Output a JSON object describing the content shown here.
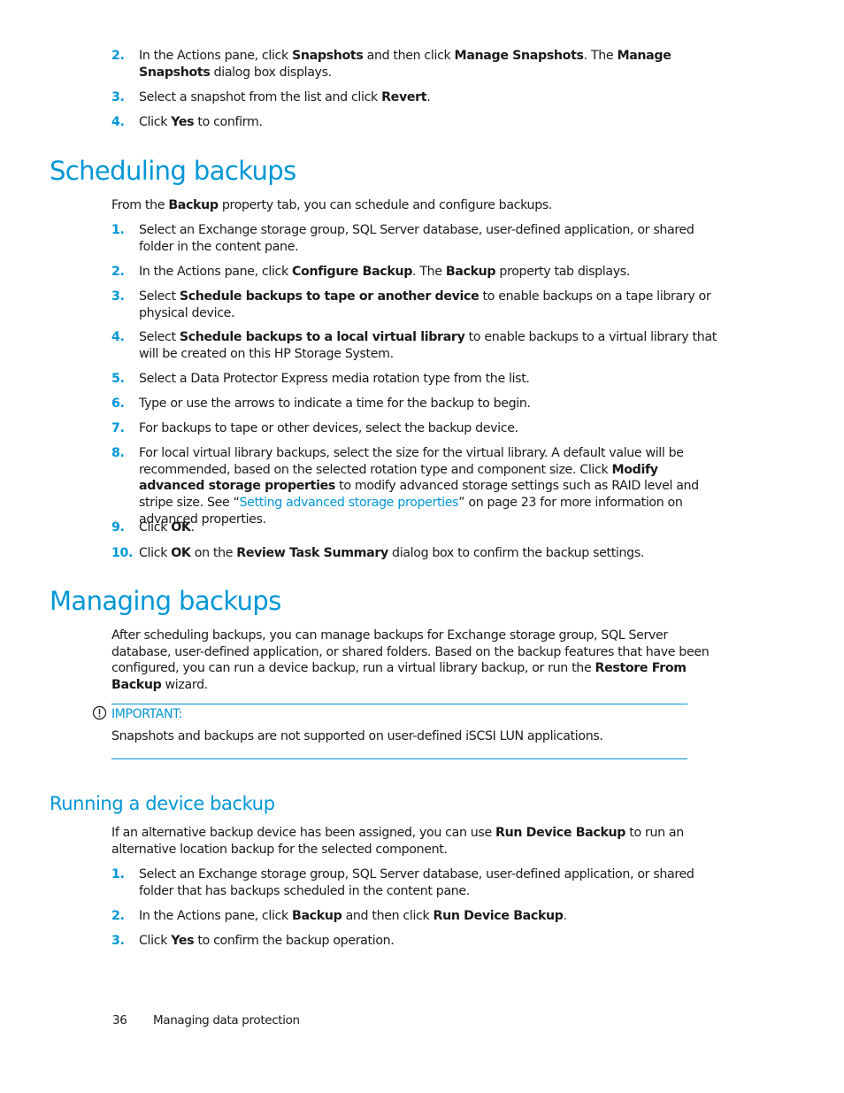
{
  "intro_steps": [
    {
      "num": "2.",
      "parts": [
        [
          "In the Actions pane, click ",
          false
        ],
        [
          "Snapshots",
          true
        ],
        [
          " and then click ",
          false
        ],
        [
          "Manage Snapshots",
          true
        ],
        [
          ". The ",
          false
        ],
        [
          "Manage Snapshots",
          true
        ],
        [
          " dialog box displays.",
          false
        ]
      ]
    },
    {
      "num": "3.",
      "parts": [
        [
          "Select a snapshot from the list and click ",
          false
        ],
        [
          "Revert",
          true
        ],
        [
          ".",
          false
        ]
      ]
    },
    {
      "num": "4.",
      "parts": [
        [
          "Click ",
          false
        ],
        [
          "Yes",
          true
        ],
        [
          " to confirm.",
          false
        ]
      ]
    }
  ],
  "scheduling": {
    "heading": "Scheduling backups",
    "intro": [
      [
        "From the ",
        false
      ],
      [
        "Backup",
        true
      ],
      [
        " property tab, you can schedule and configure backups.",
        false
      ]
    ],
    "steps": [
      {
        "num": "1.",
        "parts": [
          [
            "Select an Exchange storage group, SQL Server database, user-defined application, or shared folder in the content pane.",
            false
          ]
        ]
      },
      {
        "num": "2.",
        "parts": [
          [
            "In the Actions pane, click ",
            false
          ],
          [
            "Configure Backup",
            true
          ],
          [
            ". The ",
            false
          ],
          [
            "Backup",
            true
          ],
          [
            " property tab displays.",
            false
          ]
        ]
      },
      {
        "num": "3.",
        "parts": [
          [
            "Select ",
            false
          ],
          [
            "Schedule backups to tape or another device",
            true
          ],
          [
            " to enable backups on a tape library or physical device.",
            false
          ]
        ]
      },
      {
        "num": "4.",
        "parts": [
          [
            "Select ",
            false
          ],
          [
            "Schedule backups to a local virtual library",
            true
          ],
          [
            " to enable backups to a virtual library that will be created on this HP Storage System.",
            false
          ]
        ]
      },
      {
        "num": "5.",
        "parts": [
          [
            "Select a Data Protector Express media rotation type from the list.",
            false
          ]
        ]
      },
      {
        "num": "6.",
        "parts": [
          [
            "Type or use the arrows to indicate a time for the backup to begin.",
            false
          ]
        ]
      },
      {
        "num": "7.",
        "parts": [
          [
            "For backups to tape or other devices, select the backup device.",
            false
          ]
        ]
      },
      {
        "num": "8.",
        "parts": [
          [
            "For local virtual library backups, select the size for the virtual library. A default value will be recommended, based on the selected rotation type and component size. Click ",
            false
          ],
          [
            "Modify advanced storage properties",
            true
          ],
          [
            " to modify advanced storage settings such as RAID level and stripe size. See “",
            false
          ],
          [
            "Setting advanced storage properties",
            "link"
          ],
          [
            "” on page 23 for more information on advanced properties.",
            false
          ]
        ]
      },
      {
        "num": "9.",
        "parts": [
          [
            "Click ",
            false
          ],
          [
            "OK",
            true
          ],
          [
            ".",
            false
          ]
        ]
      },
      {
        "num": "10.",
        "parts": [
          [
            "Click ",
            false
          ],
          [
            "OK",
            true
          ],
          [
            " on the ",
            false
          ],
          [
            "Review Task Summary",
            true
          ],
          [
            " dialog box to confirm the backup settings.",
            false
          ]
        ]
      }
    ]
  },
  "managing": {
    "heading": "Managing backups",
    "intro": [
      [
        "After scheduling backups, you can manage backups for Exchange storage group, SQL Server database, user-defined application, or shared folders. Based on the backup features that have been configured, you can run a device backup, run a virtual library backup, or run the ",
        false
      ],
      [
        "Restore From Backup",
        true
      ],
      [
        " wizard.",
        false
      ]
    ],
    "important_label": "IMPORTANT:",
    "important_icon": "exclamation-circle-icon",
    "important_text": "Snapshots and backups are not supported on user-defined iSCSI LUN applications."
  },
  "device_backup": {
    "heading": "Running a device backup",
    "intro": [
      [
        "If an alternative backup device has been assigned, you can use ",
        false
      ],
      [
        "Run Device Backup",
        true
      ],
      [
        " to run an alternative location backup for the selected component.",
        false
      ]
    ],
    "steps": [
      {
        "num": "1.",
        "parts": [
          [
            "Select an Exchange storage group, SQL Server database, user-defined application, or shared folder that has backups scheduled in the content pane.",
            false
          ]
        ]
      },
      {
        "num": "2.",
        "parts": [
          [
            "In the Actions pane, click ",
            false
          ],
          [
            "Backup",
            true
          ],
          [
            " and then click ",
            false
          ],
          [
            "Run Device Backup",
            true
          ],
          [
            ".",
            false
          ]
        ]
      },
      {
        "num": "3.",
        "parts": [
          [
            "Click ",
            false
          ],
          [
            "Yes",
            true
          ],
          [
            " to confirm the backup operation.",
            false
          ]
        ]
      }
    ]
  },
  "footer": {
    "page_number": "36",
    "chapter": "Managing data protection"
  },
  "colors": {
    "accent": "#0096d6",
    "text": "#1a1a1a"
  }
}
